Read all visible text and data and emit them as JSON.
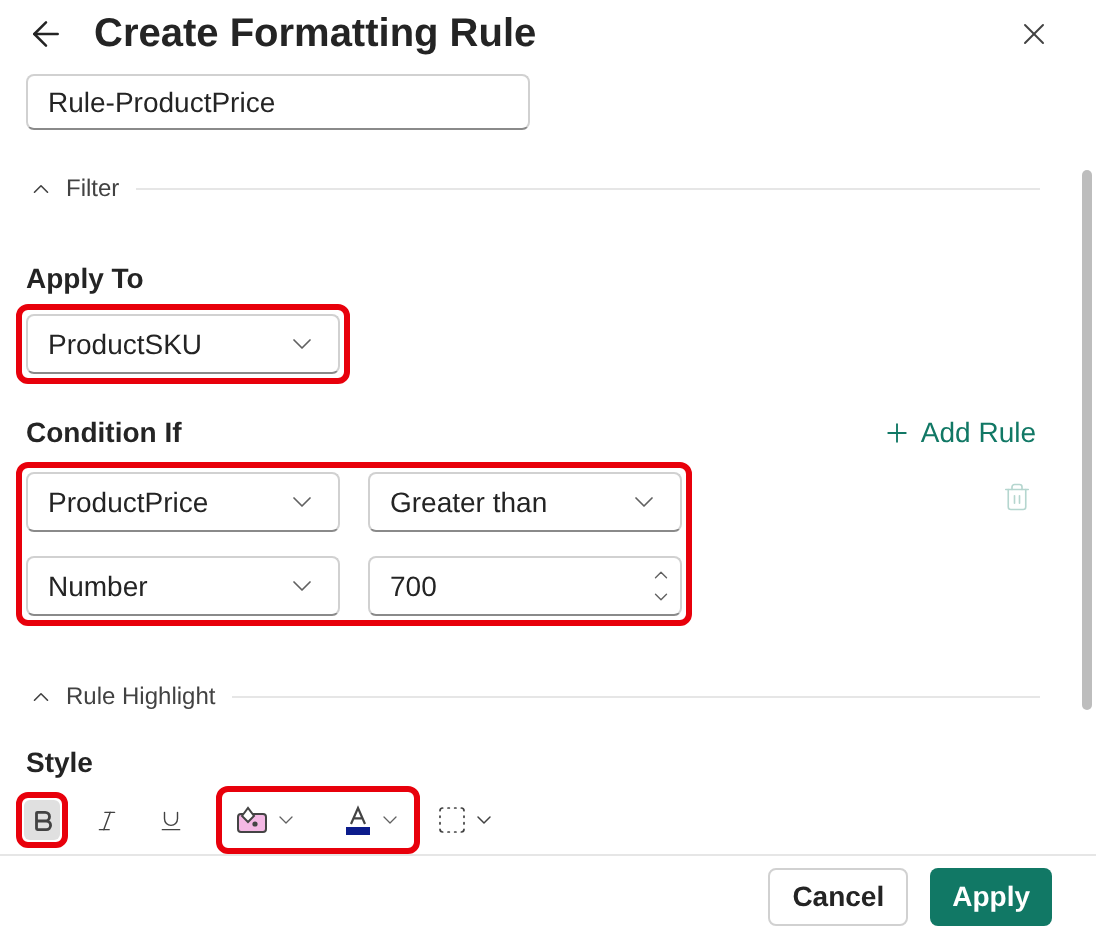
{
  "dialog": {
    "title": "Create Formatting Rule"
  },
  "rule_name": {
    "value": "Rule-ProductPrice"
  },
  "filter_section": {
    "label": "Filter",
    "expanded": true
  },
  "apply_to": {
    "label": "Apply To",
    "value": "ProductSKU",
    "highlighted": true
  },
  "condition": {
    "label": "Condition If",
    "add_label": "Add Rule",
    "highlighted": true,
    "rows": [
      {
        "fields": [
          {
            "kind": "select",
            "value": "ProductPrice"
          },
          {
            "kind": "select",
            "value": "Greater than"
          }
        ],
        "deletable": true
      },
      {
        "fields": [
          {
            "kind": "select",
            "value": "Number"
          },
          {
            "kind": "number",
            "value": "700"
          }
        ],
        "deletable": false
      }
    ]
  },
  "highlight_section": {
    "label": "Rule Highlight",
    "expanded": true
  },
  "style": {
    "label": "Style",
    "tools": [
      {
        "kind": "bold",
        "selected": true,
        "highlighted": true
      },
      {
        "kind": "italic",
        "selected": false,
        "highlighted": false
      },
      {
        "kind": "underline",
        "selected": false,
        "highlighted": false
      }
    ],
    "pickers": [
      {
        "kind": "fill",
        "color": "#f4b8e4"
      },
      {
        "kind": "font",
        "color": "#0c1c8c"
      }
    ],
    "pickers_highlighted": true
  },
  "buttons": [
    {
      "label": "Cancel",
      "kind": "secondary"
    },
    {
      "label": "Apply",
      "kind": "primary"
    }
  ]
}
